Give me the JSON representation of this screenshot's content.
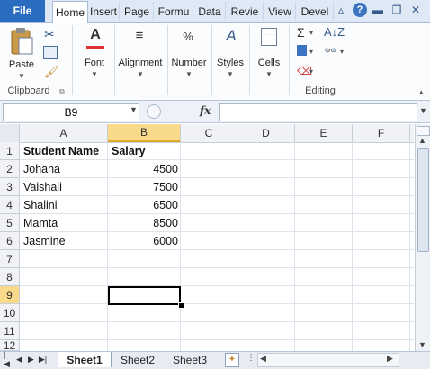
{
  "tabs": {
    "file": "File",
    "items": [
      "Home",
      "Insert",
      "Page",
      "Formu",
      "Data",
      "Revie",
      "View",
      "Devel"
    ]
  },
  "ribbon": {
    "clipboard": {
      "paste": "Paste",
      "group_label": "Clipboard"
    },
    "font": {
      "label": "Font"
    },
    "alignment": {
      "label": "Alignment"
    },
    "number": {
      "label": "Number"
    },
    "styles": {
      "label": "Styles"
    },
    "cells": {
      "label": "Cells"
    },
    "editing": {
      "group_label": "Editing"
    }
  },
  "formula_bar": {
    "name_box": "B9",
    "fx": "fx",
    "formula": ""
  },
  "grid": {
    "columns": [
      "A",
      "B",
      "C",
      "D",
      "E",
      "F"
    ],
    "rows": [
      "1",
      "2",
      "3",
      "4",
      "5",
      "6",
      "7",
      "8",
      "9",
      "10",
      "11",
      "12"
    ],
    "header": {
      "name": "Student Name",
      "salary": "Salary"
    },
    "data": [
      {
        "name": "Johana",
        "salary": "4500"
      },
      {
        "name": "Vaishali",
        "salary": "7500"
      },
      {
        "name": "Shalini",
        "salary": "6500"
      },
      {
        "name": "Mamta",
        "salary": "8500"
      },
      {
        "name": "Jasmine",
        "salary": "6000"
      }
    ],
    "selected_cell": "B9"
  },
  "sheets": [
    "Sheet1",
    "Sheet2",
    "Sheet3"
  ],
  "colors": {
    "accent": "#2a6cbf",
    "selection_header": "#f9d98a"
  }
}
